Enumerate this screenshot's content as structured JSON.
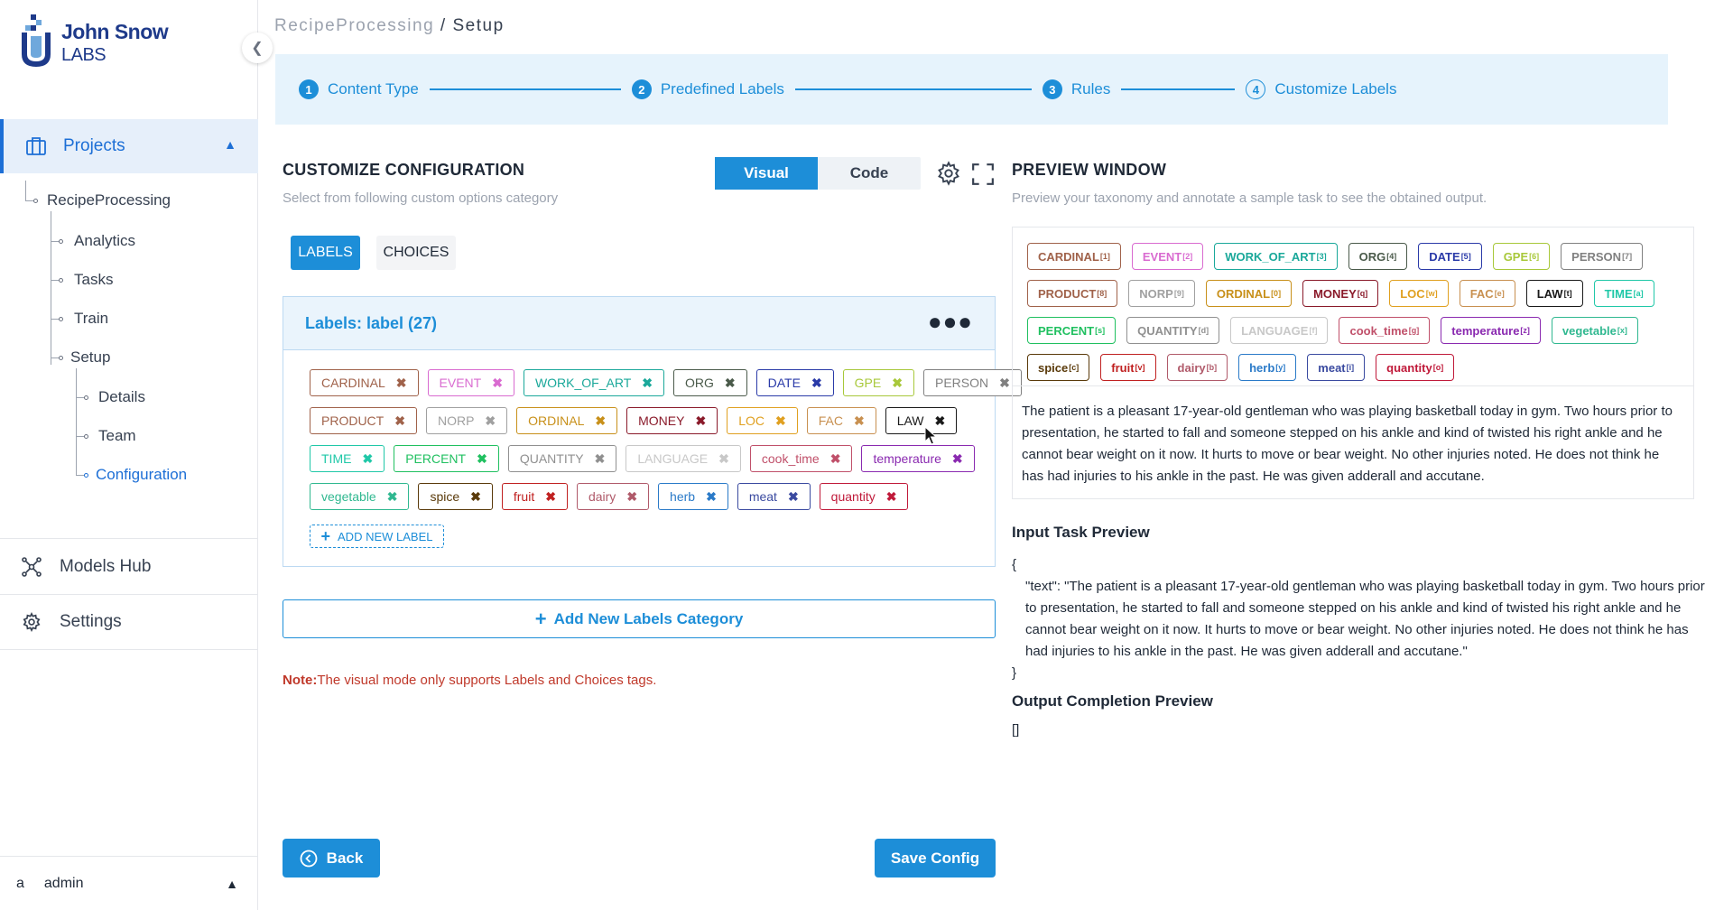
{
  "brand": {
    "line1": "John Snow",
    "line2": "LABS"
  },
  "sidebar": {
    "projects_label": "Projects",
    "tree": {
      "project": "RecipeProcessing",
      "items": [
        "Analytics",
        "Tasks",
        "Train",
        "Setup"
      ],
      "setup_children": [
        "Details",
        "Team",
        "Configuration"
      ]
    },
    "models_hub": "Models Hub",
    "settings": "Settings",
    "user_initial": "a",
    "user_name": "admin"
  },
  "breadcrumb": {
    "project": "RecipeProcessing",
    "separator": " / ",
    "page": "Setup"
  },
  "stepper": [
    {
      "num": "1",
      "label": "Content Type"
    },
    {
      "num": "2",
      "label": "Predefined Labels"
    },
    {
      "num": "3",
      "label": "Rules"
    },
    {
      "num": "4",
      "label": "Customize Labels"
    }
  ],
  "config": {
    "title": "CUSTOMIZE CONFIGURATION",
    "subtitle": "Select from following custom options category",
    "mode_visual": "Visual",
    "mode_code": "Code",
    "tab_labels": "LABELS",
    "tab_choices": "CHOICES",
    "panel_title": "Labels: label (27)",
    "add_label": "ADD NEW LABEL",
    "add_category": "Add New Labels Category",
    "note_prefix": "Note:",
    "note_text": "The visual mode only supports Labels and Choices tags.",
    "back": "Back",
    "save": "Save Config"
  },
  "labels": [
    [
      {
        "name": "CARDINAL",
        "color": "#a0624a"
      },
      {
        "name": "EVENT",
        "color": "#d96bd0"
      },
      {
        "name": "WORK_OF_ART",
        "color": "#1aa89a"
      },
      {
        "name": "ORG",
        "color": "#4a5a4a"
      },
      {
        "name": "DATE",
        "color": "#2a3aa8"
      },
      {
        "name": "GPE",
        "color": "#a8c83a"
      },
      {
        "name": "PERSON",
        "color": "#808080"
      }
    ],
    [
      {
        "name": "PRODUCT",
        "color": "#a0624a"
      },
      {
        "name": "NORP",
        "color": "#a0a0a0"
      },
      {
        "name": "ORDINAL",
        "color": "#c8901a"
      },
      {
        "name": "MONEY",
        "color": "#8a1a2a"
      },
      {
        "name": "LOC",
        "color": "#e0a020"
      },
      {
        "name": "FAC",
        "color": "#c89050"
      },
      {
        "name": "LAW",
        "color": "#1a1a1a"
      }
    ],
    [
      {
        "name": "TIME",
        "color": "#20c8a8"
      },
      {
        "name": "PERCENT",
        "color": "#20c060"
      },
      {
        "name": "QUANTITY",
        "color": "#909090"
      },
      {
        "name": "LANGUAGE",
        "color": "#c8c8c8"
      },
      {
        "name": "cook_time",
        "color": "#c0506a"
      },
      {
        "name": "temperature",
        "color": "#8a2ab0"
      }
    ],
    [
      {
        "name": "vegetable",
        "color": "#30b890"
      },
      {
        "name": "spice",
        "color": "#5a3a0a"
      },
      {
        "name": "fruit",
        "color": "#c02020"
      },
      {
        "name": "dairy",
        "color": "#b05a6a"
      },
      {
        "name": "herb",
        "color": "#2a7ac8"
      },
      {
        "name": "meat",
        "color": "#3a4aa0"
      },
      {
        "name": "quantity",
        "color": "#c01a3a"
      }
    ]
  ],
  "preview": {
    "title": "PREVIEW WINDOW",
    "subtitle": "Preview your taxonomy and annotate a sample task to see the obtained output.",
    "chips": [
      [
        {
          "name": "CARDINAL",
          "sup": "[1]",
          "color": "#a0624a"
        },
        {
          "name": "EVENT",
          "sup": "[2]",
          "color": "#d96bd0"
        },
        {
          "name": "WORK_OF_ART",
          "sup": "[3]",
          "color": "#1aa89a"
        },
        {
          "name": "ORG",
          "sup": "[4]",
          "color": "#4a5a4a"
        },
        {
          "name": "DATE",
          "sup": "[5]",
          "color": "#2a3aa8"
        },
        {
          "name": "GPE",
          "sup": "[6]",
          "color": "#a8c83a"
        },
        {
          "name": "PERSON",
          "sup": "[7]",
          "color": "#808080"
        }
      ],
      [
        {
          "name": "PRODUCT",
          "sup": "[8]",
          "color": "#a0624a"
        },
        {
          "name": "NORP",
          "sup": "[9]",
          "color": "#a0a0a0"
        },
        {
          "name": "ORDINAL",
          "sup": "[0]",
          "color": "#c8901a"
        },
        {
          "name": "MONEY",
          "sup": "[q]",
          "color": "#8a1a2a"
        },
        {
          "name": "LOC",
          "sup": "[w]",
          "color": "#e0a020"
        },
        {
          "name": "FAC",
          "sup": "[e]",
          "color": "#c89050"
        },
        {
          "name": "LAW",
          "sup": "[t]",
          "color": "#1a1a1a"
        },
        {
          "name": "TIME",
          "sup": "[a]",
          "color": "#20c8a8"
        }
      ],
      [
        {
          "name": "PERCENT",
          "sup": "[s]",
          "color": "#20c060"
        },
        {
          "name": "QUANTITY",
          "sup": "[d]",
          "color": "#909090"
        },
        {
          "name": "LANGUAGE",
          "sup": "[f]",
          "color": "#c8c8c8"
        },
        {
          "name": "cook_time",
          "sup": "[g]",
          "color": "#c0506a"
        },
        {
          "name": "temperature",
          "sup": "[z]",
          "color": "#8a2ab0"
        },
        {
          "name": "vegetable",
          "sup": "[x]",
          "color": "#30b890"
        }
      ],
      [
        {
          "name": "spice",
          "sup": "[c]",
          "color": "#5a3a0a"
        },
        {
          "name": "fruit",
          "sup": "[v]",
          "color": "#c02020"
        },
        {
          "name": "dairy",
          "sup": "[b]",
          "color": "#b05a6a"
        },
        {
          "name": "herb",
          "sup": "[y]",
          "color": "#2a7ac8"
        },
        {
          "name": "meat",
          "sup": "[i]",
          "color": "#3a4aa0"
        },
        {
          "name": "quantity",
          "sup": "[o]",
          "color": "#c01a3a"
        }
      ]
    ],
    "text": "The patient is a pleasant 17-year-old gentleman who was playing basketball today in gym. Two hours prior to presentation, he started to fall and someone stepped on his ankle and kind of twisted his right ankle and he cannot bear weight on it now. It hurts to move or bear weight. No other injuries noted. He does not think he has had injuries to his ankle in the past. He was given adderall and accutane.",
    "input_title": "Input Task Preview",
    "json_open": "{",
    "json_line": "\"text\": \"The patient is a pleasant 17-year-old gentleman who was playing basketball today in gym. Two hours prior to presentation, he started to fall and someone stepped on his ankle and kind of twisted his right ankle and he cannot bear weight on it now. It hurts to move or bear weight. No other injuries noted. He does not think he has had injuries to his ankle in the past. He was given adderall and accutane.\"",
    "json_close": "}",
    "output_title": "Output Completion Preview",
    "output_value": "[]"
  },
  "colors": {
    "accent": "#1d8ed8",
    "brand": "#1e3a8a",
    "note": "#c0392b"
  }
}
